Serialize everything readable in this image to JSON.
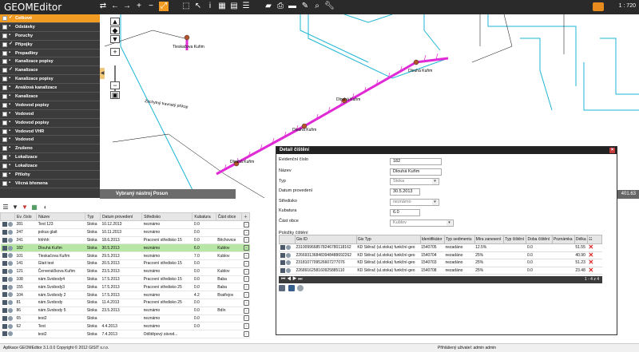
{
  "app": {
    "title": "GEOMEditor",
    "counter": "1 : 720"
  },
  "layers": [
    {
      "label": "Celkové",
      "checked": true,
      "active": true
    },
    {
      "label": "Odstávky",
      "checked": false
    },
    {
      "label": "Poruchy",
      "checked": false
    },
    {
      "label": "Přípojky",
      "checked": true
    },
    {
      "label": "Propadliny",
      "checked": false
    },
    {
      "label": "Kanalizace popisy",
      "checked": false
    },
    {
      "label": "Kanalizace",
      "checked": true
    },
    {
      "label": "Kanalizace popisy",
      "checked": false
    },
    {
      "label": "Areálová kanalizace",
      "checked": false
    },
    {
      "label": "Kanalizace",
      "checked": false
    },
    {
      "label": "Vodovod popisy",
      "checked": false
    },
    {
      "label": "Vodovod",
      "checked": false
    },
    {
      "label": "Vodovod popisy",
      "checked": false
    },
    {
      "label": "Vodovod VHR",
      "checked": false
    },
    {
      "label": "Vodovod",
      "checked": false
    },
    {
      "label": "Zrušeno",
      "checked": false
    },
    {
      "label": "Lokalizace",
      "checked": false
    },
    {
      "label": "Lokalizace",
      "checked": false
    },
    {
      "label": "Přílohy",
      "checked": false
    },
    {
      "label": "Věcná břemena",
      "checked": false
    }
  ],
  "map": {
    "labels": [
      "Tleskačova Kuřim",
      "Dlouhá Kuřim",
      "Dlouhá Kuřim",
      "Dlouhá Kuřim",
      "Dlouhá Kuřim",
      "Záchytný travnatý příkop"
    ],
    "tool_label": "Vybraný nástroj Posun",
    "coords": "401.63"
  },
  "grid": {
    "headers": [
      "Ev. číslo",
      "Název",
      "Typ",
      "Datum provedení",
      "Středisko",
      "Kubatura",
      "Část obce"
    ],
    "rows": [
      [
        "281",
        "Test 123",
        "Stoka",
        "10.12.2013",
        "neznámo",
        "0.0",
        ""
      ],
      [
        "247",
        "pokus glait",
        "Stoka",
        "10.11.2013",
        "neznámo",
        "0.0",
        ""
      ],
      [
        "241",
        "hhhhh",
        "Stoka",
        "18.6.2013",
        "Pracovní středisko 15",
        "0.0",
        "Běchovice"
      ],
      [
        "182",
        "Dlouhá Kuřim",
        "Stoka",
        "30.5.2013",
        "neznámo",
        "6.0",
        "Kublov"
      ],
      [
        "101",
        "Tleskačova Kuřim",
        "Stoka",
        "29.5.2013",
        "neznámo",
        "7.0",
        "Kublov"
      ],
      [
        "141",
        "Glait test",
        "Stoka",
        "20.5.2013",
        "Pracovní středisko 15",
        "0.0",
        ""
      ],
      [
        "121",
        "Červenáčkova Kuřim",
        "Stoka",
        "23.5.2013",
        "neznámo",
        "0.0",
        "Kublov"
      ],
      [
        "108",
        "nám.Svobody4",
        "Stoka",
        "17.5.2013",
        "Pracovní středisko 15",
        "0.0",
        "Baba"
      ],
      [
        "155",
        "nám.Svobody3",
        "Stoka",
        "17.5.2013",
        "Pracovní středisko 25",
        "0.0",
        "Baba"
      ],
      [
        "104",
        "nám.Svobody 2",
        "Stoka",
        "17.5.2013",
        "neznámo",
        "4.2",
        "Bratřejov"
      ],
      [
        "81",
        "nám.Svobody",
        "Stoka",
        "11.4.2013",
        "Pracovní středisko 25",
        "0.0",
        ""
      ],
      [
        "86",
        "nám.Svobody 5",
        "Stoka",
        "23.5.2013",
        "neznámo",
        "0.0",
        "Bdín"
      ],
      [
        "65",
        "test2",
        "Stoka",
        "",
        "neznámo",
        "0.0",
        ""
      ],
      [
        "62",
        "Test",
        "Stoka",
        "4.4.2013",
        "neznámo",
        "0.0",
        ""
      ],
      [
        "",
        "test2",
        "Stoka",
        "7.4.2013",
        "Odštěpový závod...",
        "",
        ""
      ]
    ],
    "selected_index": 3
  },
  "dialog": {
    "title": "Detail čištění",
    "fields": {
      "ev_label": "Evidenční číslo",
      "ev_value": "182",
      "nazev_label": "Název",
      "nazev_value": "Dlouhá Kuřim",
      "typ_label": "Typ",
      "typ_value": "Stoka",
      "datum_label": "Datum provedení",
      "datum_value": "30.5.2013",
      "stredisko_label": "Středisko",
      "stredisko_value": "neznámo",
      "kubatura_label": "Kubatura",
      "kubatura_value": "6.0",
      "cast_label": "Část obce",
      "cast_value": "Kublov"
    },
    "sub_title": "Položky čištění",
    "sub_headers": [
      "Gis ID",
      "Gis Typ",
      "Identifikátor",
      "Typ sedimentu",
      "Míra zanesení",
      "Typ čištění",
      "Doba čištění",
      "Poznámka",
      "Délka"
    ],
    "sub_rows": [
      [
        "2310099668578246780118162",
        "KD Stěrač (ul.stoka) funkční-geo",
        "1540705",
        "nezadáno",
        "12.5%",
        "",
        "0.0",
        "",
        "51.55"
      ],
      [
        "2266931368483948488692262",
        "KD Stěrač (ul.stoka) funkční-geo",
        "1540704",
        "nezadáno",
        "25%",
        "",
        "0.0",
        "",
        "40.90"
      ],
      [
        "2318107709526607277076",
        "KD Stěrač (ul.stoka) funkční-geo",
        "1540703",
        "nezadáno",
        "25%",
        "",
        "0.0",
        "",
        "51.23"
      ],
      [
        "2268916258160925885110",
        "KD Stěrač (ul.stoka) funkční-geo",
        "1540708",
        "nezadáno",
        "25%",
        "",
        "0.0",
        "",
        "23.48"
      ]
    ],
    "pager_info": "1 - 4 z 4"
  },
  "status": {
    "left": "Aplikace GEOMEditor 3.1.0.0 Copyright © 2012 GISIT s.r.o.",
    "right": "Přihlášený uživatel: admin admin"
  },
  "colors": {
    "accent": "#f29b22",
    "pipe": "#e02ad6",
    "water": "#1fb6d6",
    "selected_row": "#b8e6a4"
  }
}
